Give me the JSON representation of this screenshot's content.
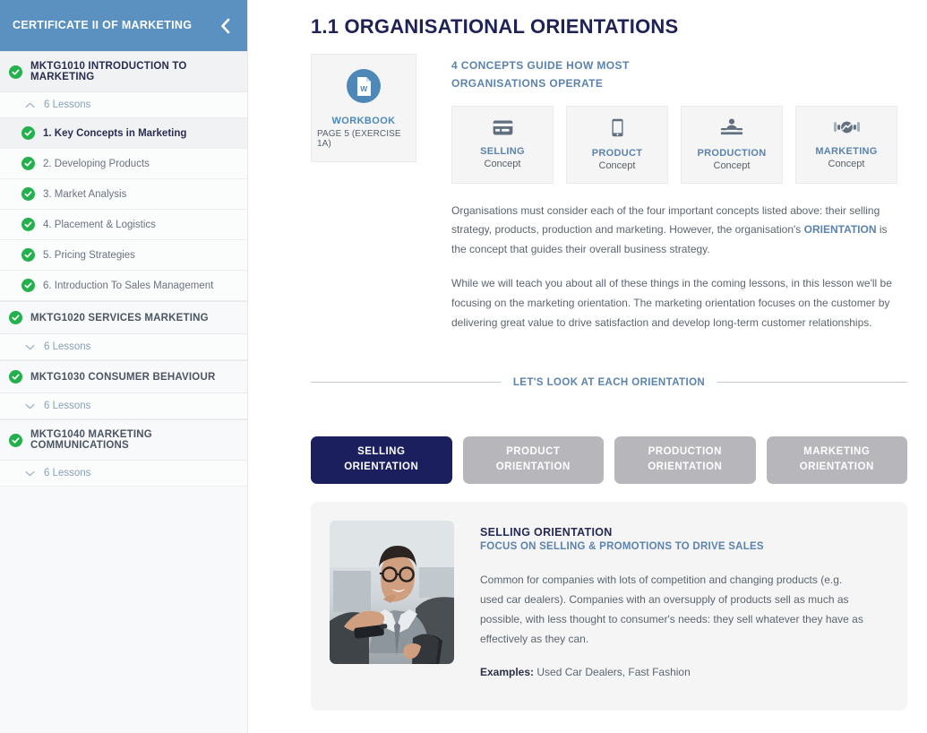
{
  "sidebar": {
    "title": "CERTIFICATE II OF MARKETING",
    "collapse_icon": "chevron-left-icon",
    "header_color": "#5b91c0",
    "modules": [
      {
        "code_title": "MKTG1010 INTRODUCTION TO MARKETING",
        "status_icon": "check-circle-icon",
        "lessons_label": "6 Lessons",
        "expanded": true,
        "toggle_icon": "chevron-up-icon",
        "lessons": [
          {
            "label": "1. Key Concepts in Marketing",
            "status_icon": "check-circle-icon",
            "active": true
          },
          {
            "label": "2. Developing Products",
            "status_icon": "check-circle-icon",
            "active": false
          },
          {
            "label": "3. Market Analysis",
            "status_icon": "check-circle-icon",
            "active": false
          },
          {
            "label": "4. Placement & Logistics",
            "status_icon": "check-circle-icon",
            "active": false
          },
          {
            "label": "5. Pricing Strategies",
            "status_icon": "check-circle-icon",
            "active": false
          },
          {
            "label": "6. Introduction To Sales Management",
            "status_icon": "check-circle-icon",
            "active": false
          }
        ]
      },
      {
        "code_title": "MKTG1020 SERVICES MARKETING",
        "status_icon": "check-circle-icon",
        "lessons_label": "6 Lessons",
        "expanded": false,
        "toggle_icon": "chevron-down-icon",
        "lessons": []
      },
      {
        "code_title": "MKTG1030 CONSUMER BEHAVIOUR",
        "status_icon": "check-circle-icon",
        "lessons_label": "6 Lessons",
        "expanded": false,
        "toggle_icon": "chevron-down-icon",
        "lessons": []
      },
      {
        "code_title": "MKTG1040 MARKETING COMMUNICATIONS",
        "status_icon": "check-circle-icon",
        "lessons_label": "6 Lessons",
        "expanded": false,
        "toggle_icon": "chevron-down-icon",
        "lessons": []
      }
    ]
  },
  "main": {
    "page_title": "1.1 ORGANISATIONAL ORIENTATIONS",
    "workbook": {
      "icon": "word-document-icon",
      "title": "WORKBOOK",
      "subtitle": "PAGE 5 (EXERCISE 1A)"
    },
    "kicker": "4 CONCEPTS GUIDE HOW MOST ORGANISATIONS OPERATE",
    "concepts": [
      {
        "name": "SELLING",
        "sub": "Concept",
        "icon": "credit-card-icon"
      },
      {
        "name": "PRODUCT",
        "sub": "Concept",
        "icon": "mobile-phone-icon"
      },
      {
        "name": "PRODUCTION",
        "sub": "Concept",
        "icon": "conveyor-belt-icon"
      },
      {
        "name": "MARKETING",
        "sub": "Concept",
        "icon": "handshake-icon"
      }
    ],
    "paragraphs": {
      "p1_before": "Organisations must consider each of the four important concepts listed above: their selling strategy, products, production and marketing. However, the organisation's ",
      "p1_highlight": "ORIENTATION",
      "p1_after": " is the concept that guides their overall business strategy.",
      "p2": "While we will teach you about all of these things in the coming lessons, in this lesson we'll be focusing on the marketing orientation. The marketing orientation focuses on the customer by delivering great value to drive satisfaction and develop long-term customer relationships."
    },
    "divider_label": "LET'S LOOK AT EACH ORIENTATION",
    "tabs": [
      {
        "line1": "SELLING",
        "line2": "ORIENTATION",
        "active": true
      },
      {
        "line1": "PRODUCT",
        "line2": "ORIENTATION",
        "active": false
      },
      {
        "line1": "PRODUCTION",
        "line2": "ORIENTATION",
        "active": false
      },
      {
        "line1": "MARKETING",
        "line2": "ORIENTATION",
        "active": false
      }
    ],
    "detail": {
      "photo_alt": "smiling-salesman-handing-car-keys-photo",
      "title": "SELLING ORIENTATION",
      "subtitle": "FOCUS ON SELLING & PROMOTIONS TO DRIVE SALES",
      "text": "Common for companies with lots of competition and changing products (e.g. used car dealers). Companies with an oversupply of products sell as much as possible, with less thought to consumer's needs: they sell whatever they have as effectively as they can.",
      "examples_label": "Examples:",
      "examples_value": " Used Car Dealers, Fast Fashion"
    }
  },
  "colors": {
    "header_blue": "#5b91c0",
    "navy": "#1b1f5e",
    "accent_blue": "#5b83ad",
    "check_green": "#22b14c",
    "tab_inactive": "#b6b6bb"
  }
}
